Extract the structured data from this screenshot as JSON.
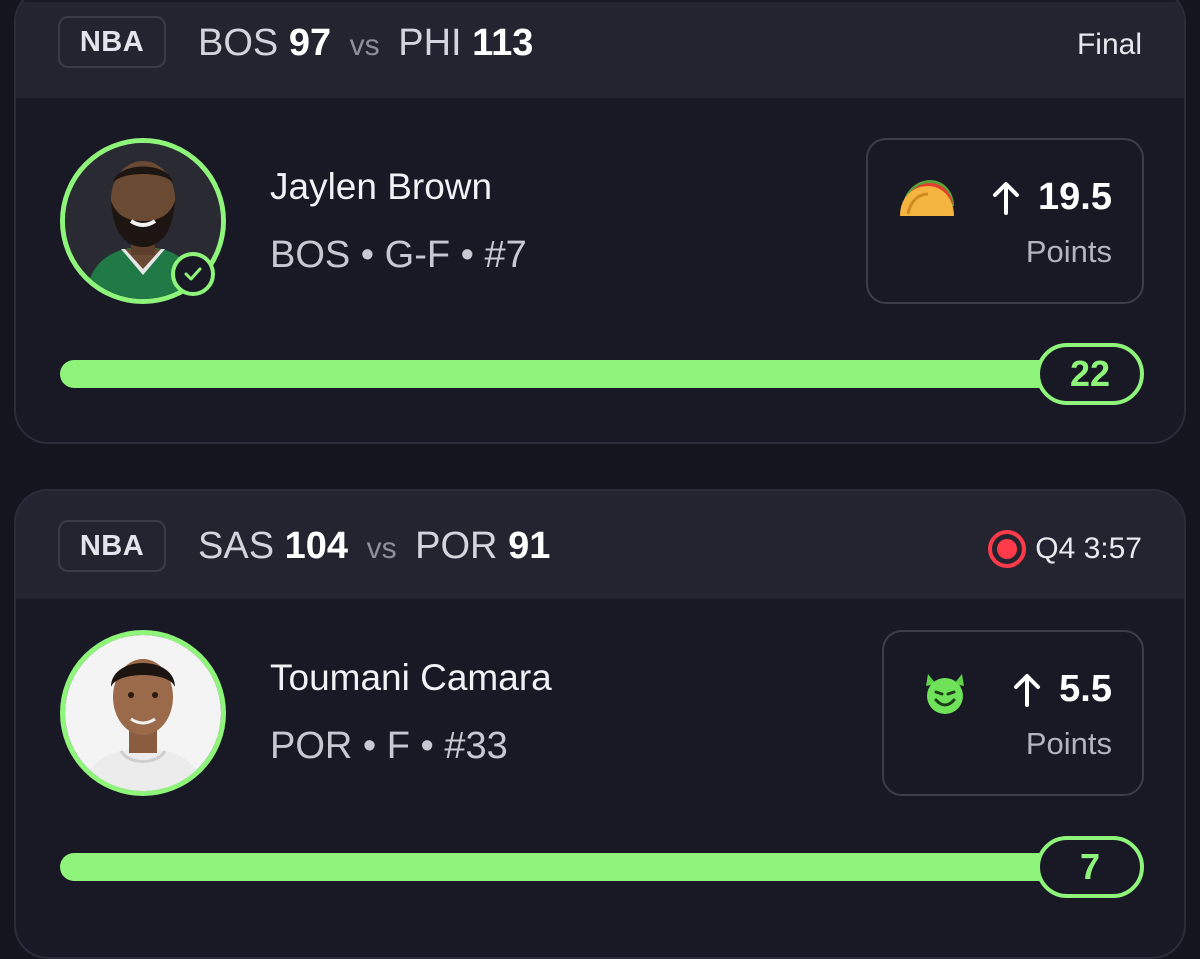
{
  "cards": [
    {
      "league": "NBA",
      "home_team": "BOS",
      "home_score": "97",
      "vs": "vs",
      "away_team": "PHI",
      "away_score": "113",
      "status": "Final",
      "player": {
        "name": "Jaylen Brown",
        "meta": "BOS • G-F • #7",
        "verified": true
      },
      "pick": {
        "emoji_icon": "taco-icon",
        "direction": "up-arrow-icon",
        "line": "19.5",
        "stat": "Points"
      },
      "result": "22",
      "progress_fraction": 1.0
    },
    {
      "league": "NBA",
      "home_team": "SAS",
      "home_score": "104",
      "vs": "vs",
      "away_team": "POR",
      "away_score": "91",
      "status": "Q4 3:57",
      "status_icon": "live-record-icon",
      "player": {
        "name": "Toumani Camara",
        "meta": "POR • F • #33"
      },
      "pick": {
        "emoji_icon": "smiling-devil-icon",
        "direction": "up-arrow-icon",
        "line": "5.5",
        "stat": "Points"
      },
      "result": "7",
      "progress_fraction": 1.0
    }
  ],
  "colors": {
    "accent": "#8ef57a",
    "live": "#ff3b4a",
    "background": "#15151f",
    "card": "#191926",
    "header": "#242431"
  }
}
